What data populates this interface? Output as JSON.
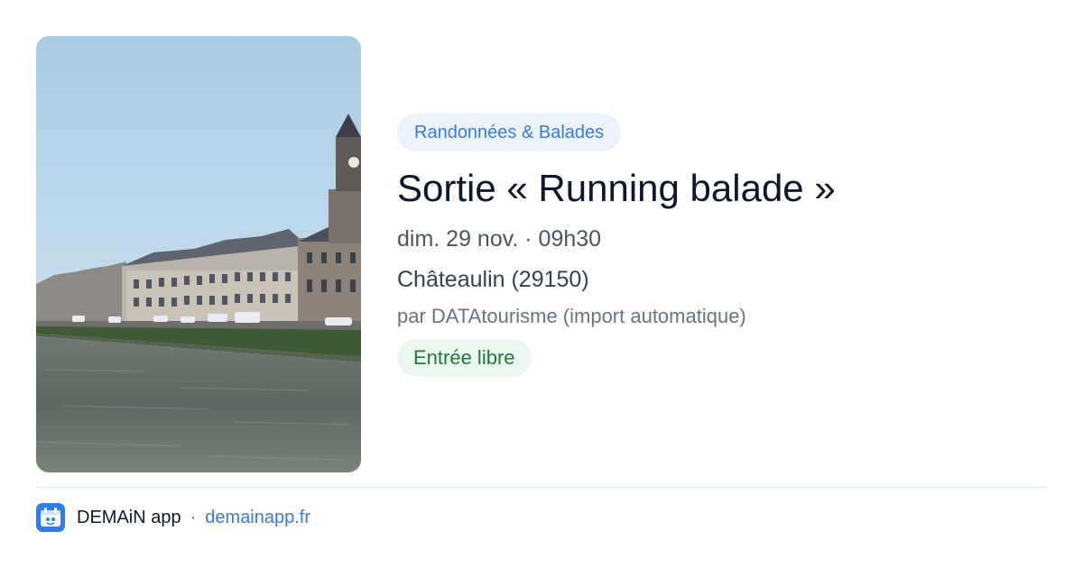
{
  "event": {
    "image": {
      "description": "photo"
    },
    "category": "Randonnées & Balades",
    "title": "Sortie « Running balade »",
    "datetime": "dim. 29 nov. · 09h30",
    "location": "Châteaulin (29150)",
    "organizer": "par DATAtourisme (import automatique)",
    "price": "Entrée libre"
  },
  "footer": {
    "app_name": "DEMAiN app",
    "separator": "·",
    "url": "demainapp.fr"
  },
  "colors": {
    "accent": "#3b7bd6",
    "category_bg": "#ecf3fd",
    "price_text": "#1f7a3a",
    "price_bg": "#ebf8ef"
  }
}
